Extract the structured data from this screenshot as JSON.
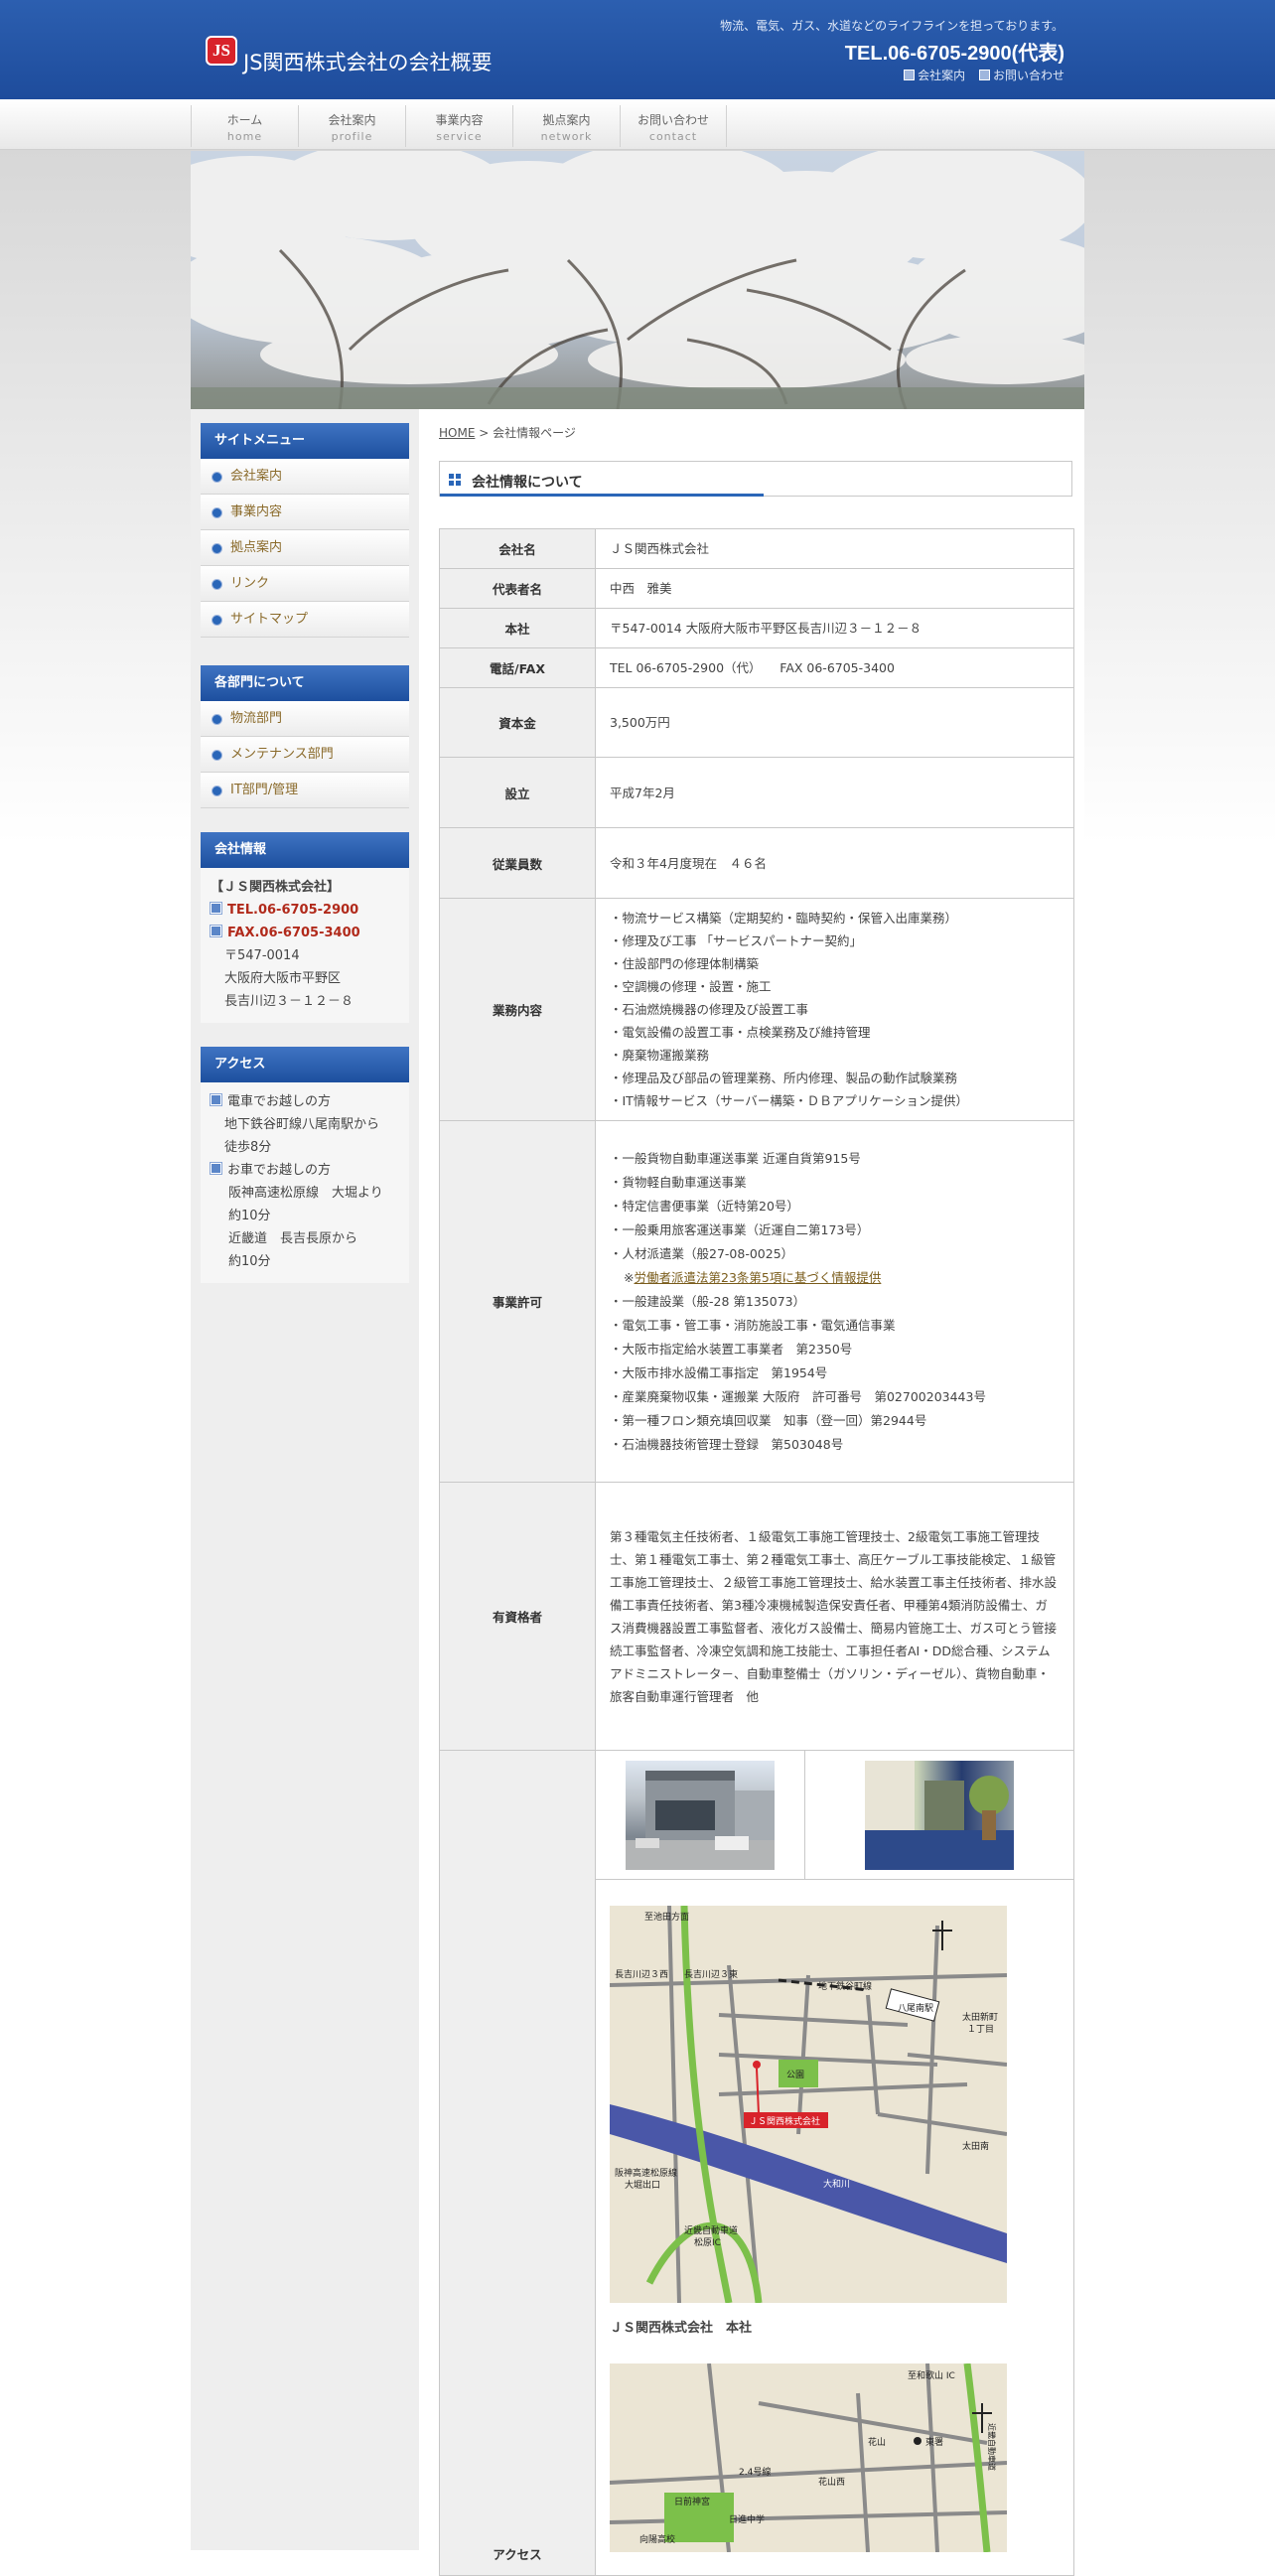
{
  "header": {
    "logo": "JS",
    "title": "JS関西株式会社の会社概要",
    "tagline": "物流、電気、ガス、水道などのライフラインを担っております。",
    "tel": "TEL.06-6705-2900(代表)",
    "links": [
      "会社案内",
      "お問い合わせ"
    ]
  },
  "nav": [
    {
      "ja": "ホーム",
      "en": "home"
    },
    {
      "ja": "会社案内",
      "en": "profile"
    },
    {
      "ja": "事業内容",
      "en": "service"
    },
    {
      "ja": "拠点案内",
      "en": "network"
    },
    {
      "ja": "お問い合わせ",
      "en": "contact"
    }
  ],
  "sidebar": {
    "menu_title": "サイトメニュー",
    "menu": [
      "会社案内",
      "事業内容",
      "拠点案内",
      "リンク",
      "サイトマップ"
    ],
    "dept_title": "各部門について",
    "depts": [
      "物流部門",
      "メンテナンス部門",
      "IT部門/管理"
    ],
    "company_title": "会社情報",
    "company": {
      "name": "【ＪＳ関西株式会社】",
      "tel": "TEL.06-6705-2900",
      "fax": "FAX.06-6705-3400",
      "zip": "〒547-0014",
      "addr1": "大阪府大阪市平野区",
      "addr2": "長吉川辺３－１２－８"
    },
    "access_title": "アクセス",
    "access": {
      "train_head": "電車でお越しの方",
      "train_1": "地下鉄谷町線八尾南駅から",
      "train_2": "徒歩8分",
      "car_head": "お車でお越しの方",
      "car_1": "阪神高速松原線　大堀より",
      "car_2": "約10分",
      "car_3": "近畿道　長吉長原から",
      "car_4": "約10分"
    }
  },
  "breadcrumb": {
    "home": "HOME",
    "sep": " > ",
    "current": "会社情報ページ"
  },
  "section_title": "会社情報について",
  "table": {
    "company_name_label": "会社名",
    "company_name": "ＪＳ関西株式会社",
    "rep_label": "代表者名",
    "rep": "中西　雅美",
    "hq_label": "本社",
    "hq": "〒547-0014 大阪府大阪市平野区長吉川辺３－１２－８",
    "phone_label": "電話/FAX",
    "phone": "TEL 06-6705-2900（代）　　FAX 06-6705-3400",
    "capital_label": "資本金",
    "capital": "3,500万円",
    "founded_label": "設立",
    "founded": "平成7年2月",
    "employees_label": "従業員数",
    "employees": "令和３年4月度現在　４６名",
    "business_label": "業務内容",
    "business": [
      "・物流サービス構築（定期契約・臨時契約・保管入出庫業務）",
      "・修理及び工事 「サービスパートナー契約」",
      "・住設部門の修理体制構築",
      "・空調機の修理・設置・施工",
      "・石油燃焼機器の修理及び設置工事",
      "・電気設備の設置工事・点検業務及び維持管理",
      "・廃棄物運搬業務",
      "・修理品及び部品の管理業務、所内修理、製品の動作試験業務",
      "・IT情報サービス（サーバー構築・ＤＢアプリケーション提供）"
    ],
    "license_label": "事業許可",
    "licenses_a": [
      "・一般貨物自動車運送事業 近運自貨第915号",
      "・貨物軽自動車運送事業",
      "・特定信書便事業（近特第20号）",
      "・一般乗用旅客運送事業（近運自二第173号）",
      "・人材派遣業（般27-08-0025）"
    ],
    "license_note_prefix": "※",
    "license_note_link": "労働者派遣法第23条第5項に基づく情報提供",
    "licenses_b": [
      "・一般建設業（般-28 第135073）",
      "・電気工事・管工事・消防施設工事・電気通信事業",
      "・大阪市指定給水装置工事業者　第2350号",
      "・大阪市排水設備工事指定　第1954号",
      "・産業廃棄物収集・運搬業 大阪府　許可番号　第02700203443号",
      "・第一種フロン類充填回収業　知事（登一回）第2944号",
      "・石油機器技術管理士登録　第503048号"
    ],
    "qual_label": "有資格者",
    "qualifications": "第３種電気主任技術者、１級電気工事施工管理技士、2級電気工事施工管理技士、第１種電気工事士、第２種電気工事士、高圧ケーブル工事技能検定、１級管工事施工管理技士、２級管工事施工管理技士、給水装置工事主任技術者、排水設備工事責任技術者、第3種冷凍機械製造保安責任者、甲種第4類消防設備士、ガス消費機器設置工事監督者、液化ガス設備士、簡易内管施工士、ガス可とう管接続工事監督者、冷凍空気調和施工技能士、工事担任者AI・DD総合種、システムアドミニストレータ－、自動車整備士（ガソリン・ディーゼル）、貨物自動車・旅客自動車運行管理者　他",
    "access_label": "アクセス",
    "map1_caption": "ＪＳ関西株式会社　本社",
    "map1_labels": {
      "tl": "至池田方面",
      "a": "長吉川辺３西",
      "b": "長吉川辺３東",
      "c": "地下鉄谷町線",
      "d": "八尾南駅",
      "e": "太田新町",
      "e2": "１丁目",
      "park": "公園",
      "company": "ＪＳ関西株式会社",
      "f": "阪神高速松原線",
      "f2": "大堀出口",
      "g": "太田南",
      "river": "大和川",
      "h": "近畿自動車道",
      "h2": "松原IC"
    },
    "map2_labels": {
      "a": "至和歌山 IC",
      "b": "東署",
      "c": "花山",
      "d": "2.4号線",
      "e": "花山西",
      "f": "近畿自動車道",
      "g": "日前神宮",
      "h": "日進中学",
      "i": "向陽高校"
    }
  },
  "colors": {
    "brand_blue": "#1e4c9c",
    "accent_red": "#b12a1b",
    "link_brown": "#8a6a2a"
  }
}
